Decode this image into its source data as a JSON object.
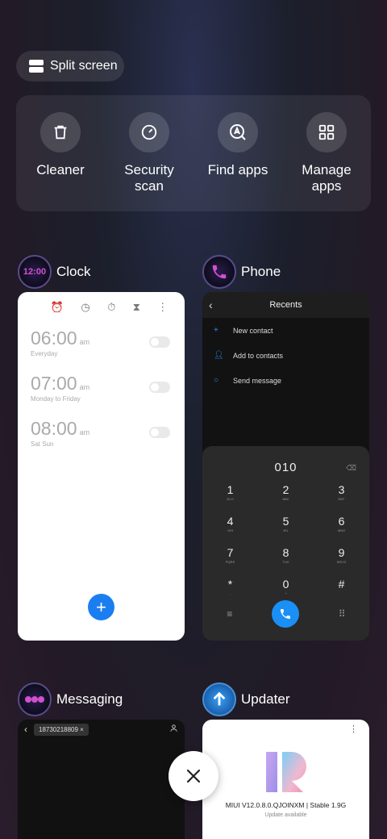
{
  "split_screen": {
    "label": "Split screen"
  },
  "tools": [
    {
      "label": "Cleaner",
      "icon": "trash-icon"
    },
    {
      "label": "Security\nscan",
      "icon": "speedometer-icon"
    },
    {
      "label": "Find apps",
      "icon": "search-app-icon"
    },
    {
      "label": "Manage\napps",
      "icon": "grid-icon"
    }
  ],
  "apps": {
    "clock": {
      "name": "Clock",
      "icon_text": "12:00",
      "alarms": [
        {
          "time": "06:00",
          "ampm": "am",
          "repeat": "Everyday"
        },
        {
          "time": "07:00",
          "ampm": "am",
          "repeat": "Monday to Friday"
        },
        {
          "time": "08:00",
          "ampm": "am",
          "repeat": "Sat Sun"
        }
      ],
      "fab": "+"
    },
    "phone": {
      "name": "Phone",
      "title": "Recents",
      "actions": [
        "New contact",
        "Add to contacts",
        "Send message"
      ],
      "dialed": "010",
      "keys": [
        {
          "d": "1",
          "l": "GLO"
        },
        {
          "d": "2",
          "l": "ABC"
        },
        {
          "d": "3",
          "l": "DEF"
        },
        {
          "d": "4",
          "l": "GHI"
        },
        {
          "d": "5",
          "l": "JKL"
        },
        {
          "d": "6",
          "l": "MNO"
        },
        {
          "d": "7",
          "l": "PQRS"
        },
        {
          "d": "8",
          "l": "TUV"
        },
        {
          "d": "9",
          "l": "WXYZ"
        },
        {
          "d": "*",
          "l": ","
        },
        {
          "d": "0",
          "l": "+"
        },
        {
          "d": "#",
          "l": ""
        }
      ]
    },
    "messaging": {
      "name": "Messaging",
      "recipient": "18730218809"
    },
    "updater": {
      "name": "Updater",
      "version": "MIUI V12.0.8.0.QJOINXM | Stable 1.9G",
      "status": "Update available"
    }
  },
  "colors": {
    "accent": "#1a7ef0",
    "call": "#1a8ff5"
  }
}
